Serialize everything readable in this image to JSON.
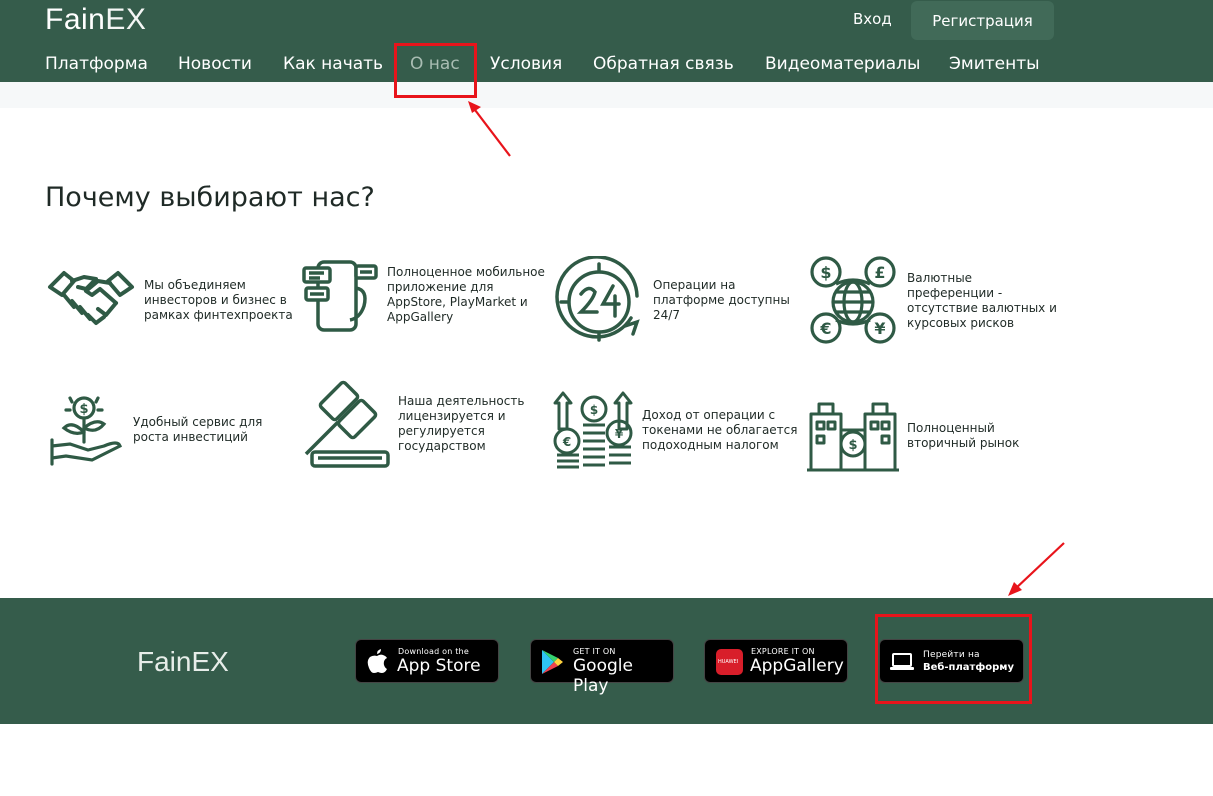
{
  "header": {
    "logo_part1": "Fain",
    "logo_part2": "EX",
    "login_label": "Вход",
    "register_label": "Регистрация"
  },
  "nav": {
    "items": [
      {
        "label": "Платформа"
      },
      {
        "label": "Новости"
      },
      {
        "label": "Как начать"
      },
      {
        "label": "О нас"
      },
      {
        "label": "Условия"
      },
      {
        "label": "Обратная связь"
      },
      {
        "label": "Видеоматериалы"
      },
      {
        "label": "Эмитенты"
      }
    ],
    "active_index": 3
  },
  "main": {
    "title": "Почему выбирают нас?",
    "features": [
      {
        "icon": "handshake-icon",
        "text": [
          "Мы объединяем",
          "инвесторов и бизнес в",
          "рамках финтехпроекта"
        ]
      },
      {
        "icon": "mobile-app-icon",
        "text": [
          "Полноценное мобильное",
          "приложение для",
          "AppStore, PlayMarket и",
          "AppGallery"
        ]
      },
      {
        "icon": "clock-24-icon",
        "text": [
          "Операции на",
          "платформе доступны",
          "24/7"
        ]
      },
      {
        "icon": "currency-globe-icon",
        "text": [
          "Валютные",
          "преференции -",
          "отсутствие валютных и",
          "курсовых рисков"
        ]
      },
      {
        "icon": "growth-plant-icon",
        "text": [
          "Удобный сервис для",
          "роста инвестиций"
        ]
      },
      {
        "icon": "gavel-icon",
        "text": [
          "Наша деятельность",
          "лицензируется и",
          "регулируется",
          "государством"
        ]
      },
      {
        "icon": "coins-growth-icon",
        "text": [
          "Доход от операции с",
          "токенами не облагается",
          "подоходным налогом"
        ]
      },
      {
        "icon": "buildings-icon",
        "text": [
          "Полноценный",
          "вторичный рынок"
        ]
      }
    ]
  },
  "footer": {
    "logo_part1": "Fain",
    "logo_part2": "EX",
    "app_store": {
      "small": "Download on the",
      "big": "App Store"
    },
    "google_play": {
      "small": "GET IT ON",
      "big": "Google Play"
    },
    "app_gallery": {
      "small": "EXPLORE IT ON",
      "big": "AppGallery",
      "badge": "HUAWEI"
    },
    "web_platform": {
      "small": "Перейти на",
      "big": "Веб-платформу"
    }
  },
  "colors": {
    "brand_green": "#355c4b",
    "icon_green": "#2f5a45",
    "highlight_red": "#e8141b"
  }
}
